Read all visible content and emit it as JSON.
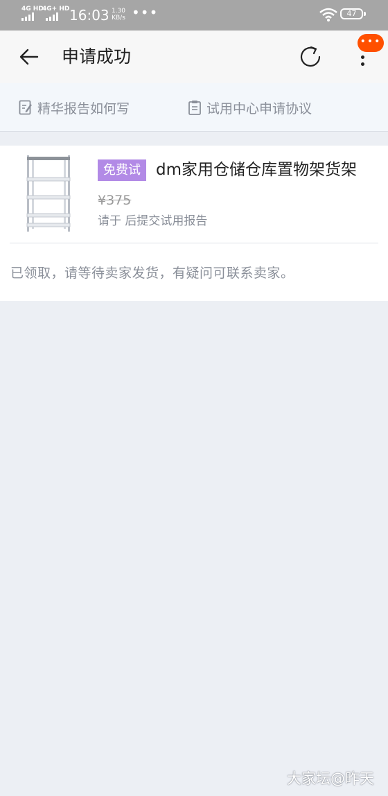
{
  "status_bar": {
    "network_1": "4G HD",
    "network_2": "4G+ HD",
    "time": "16:03",
    "speed_value": "1.30",
    "speed_unit": "KB/s",
    "more": "•••",
    "battery": "47"
  },
  "nav": {
    "back_icon": "arrow-left-icon",
    "title": "申请成功",
    "refresh_icon": "refresh-icon",
    "more_icon": "vertical-dots-icon",
    "badge": "•••",
    "badge_color": "#ff5000"
  },
  "links": {
    "report_guide": "精华报告如何写",
    "trial_agreement": "试用中心申请协议"
  },
  "product": {
    "tag": "免费试",
    "tag_color": "#b28ae6",
    "title": "dm家用仓储仓库置物架货架",
    "price": "¥375",
    "report_hint": "请于 后提交试用报告"
  },
  "message": "已领取，请等待卖家发货，有疑问可联系卖家。",
  "watermark": "大家坛@昨天"
}
